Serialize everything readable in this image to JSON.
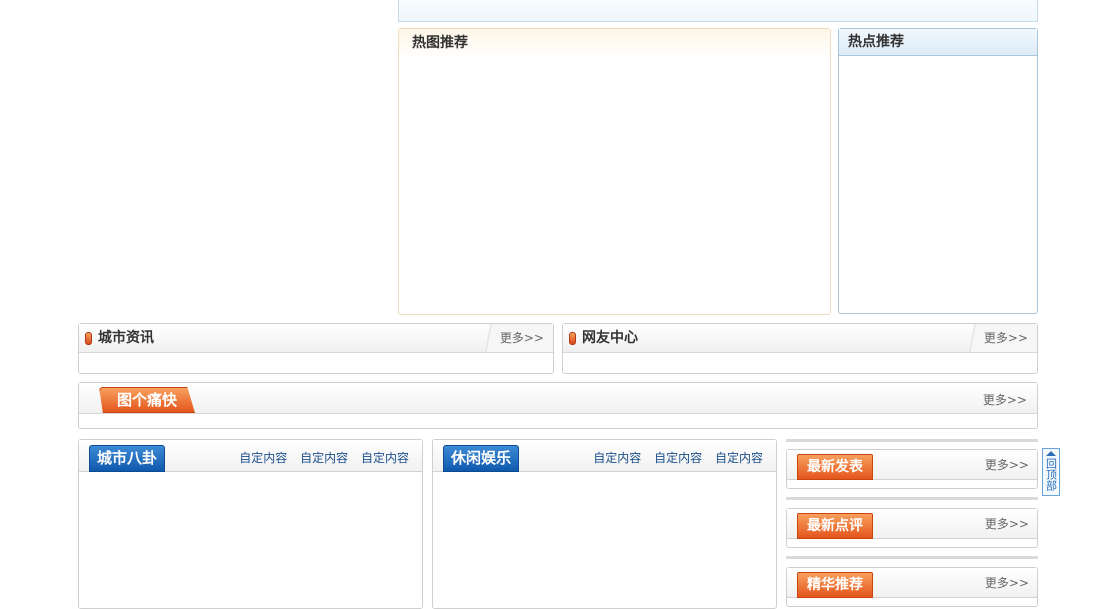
{
  "hot_pictures": {
    "title": "热图推荐"
  },
  "hot_spots": {
    "title": "热点推荐"
  },
  "city_news": {
    "title": "城市资讯",
    "more": "更多>>"
  },
  "member_center": {
    "title": "网友中心",
    "more": "更多>>"
  },
  "photo_bar": {
    "title": "图个痛快",
    "more": "更多>>"
  },
  "gossip": {
    "title": "城市八卦",
    "links": [
      "自定内容",
      "自定内容",
      "自定内容"
    ]
  },
  "leisure": {
    "title": "休闲娱乐",
    "links": [
      "自定内容",
      "自定内容",
      "自定内容"
    ]
  },
  "side": {
    "latest_posts": {
      "title": "最新发表",
      "more": "更多>>"
    },
    "latest_comments": {
      "title": "最新点评",
      "more": "更多>>"
    },
    "featured": {
      "title": "精华推荐",
      "more": "更多>>"
    }
  },
  "back_to_top": {
    "label": "回顶部"
  },
  "colors": {
    "blue_tab": "#0f59ad",
    "orange_tab": "#e4551c",
    "link": "#1c4f8a"
  }
}
